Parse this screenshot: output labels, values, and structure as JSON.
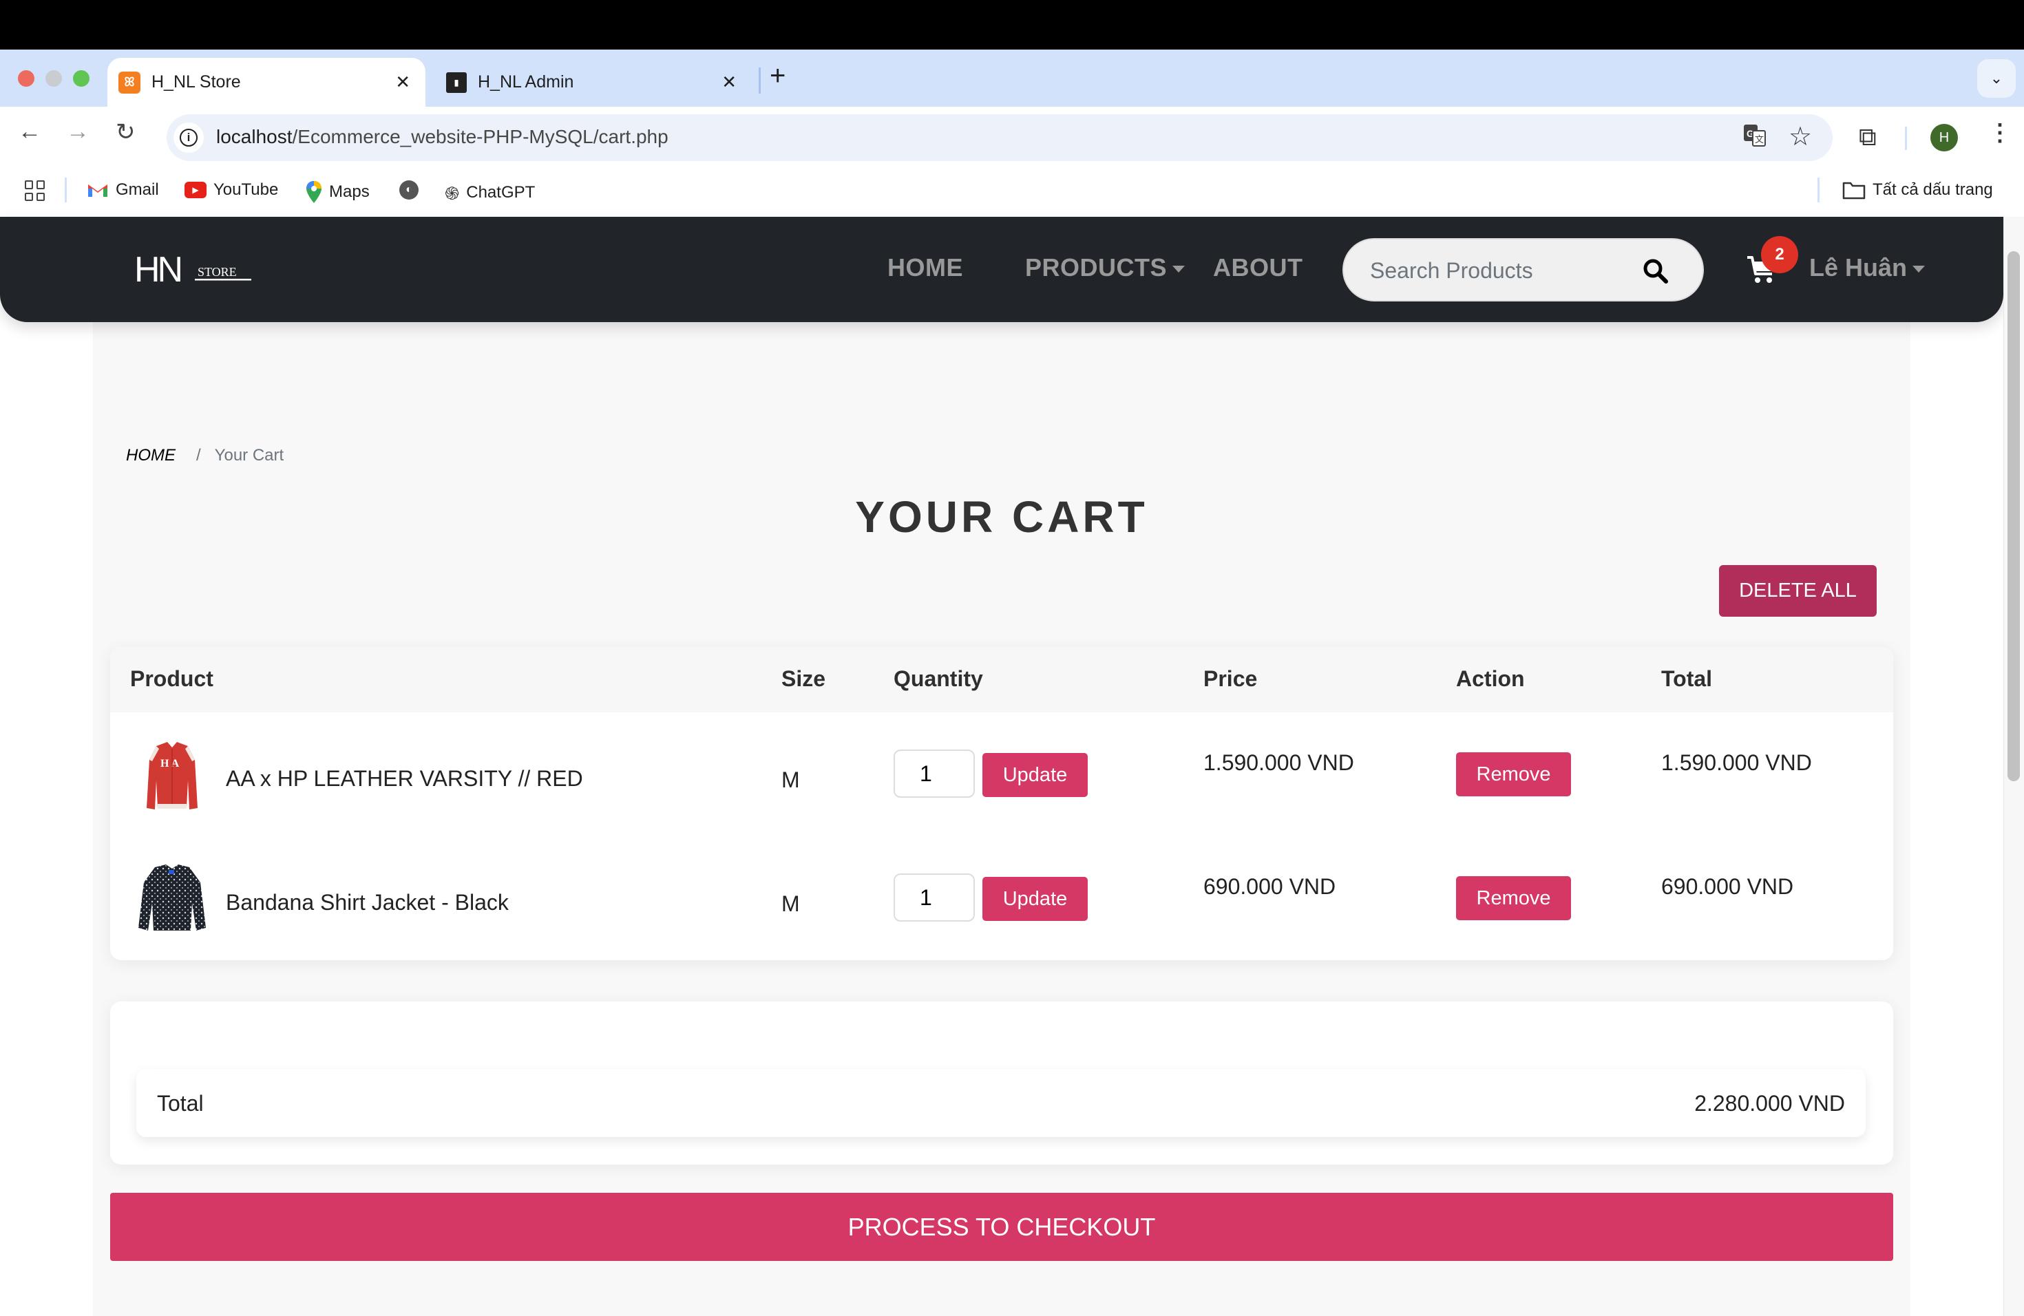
{
  "browser": {
    "tabs": [
      {
        "title": "H_NL Store",
        "active": true,
        "favicon": "xampp-icon"
      },
      {
        "title": "H_NL Admin",
        "active": false,
        "favicon": "admin-icon"
      }
    ],
    "new_tab": "+",
    "url_host": "localhost",
    "url_path": "/Ecommerce_website-PHP-MySQL/cart.php",
    "profile_initial": "H",
    "bookmarks": [
      {
        "label": "Gmail",
        "icon": "gmail-icon"
      },
      {
        "label": "YouTube",
        "icon": "youtube-icon"
      },
      {
        "label": "Maps",
        "icon": "maps-icon"
      },
      {
        "label": "",
        "icon": "globe-icon"
      },
      {
        "label": "ChatGPT",
        "icon": "chatgpt-icon"
      }
    ],
    "all_bookmarks": "Tất cả dấu trang"
  },
  "navbar": {
    "logo_main": "HN",
    "logo_sub": "STORE",
    "links": [
      "HOME",
      "PRODUCTS",
      "ABOUT"
    ],
    "search_placeholder": "Search Products",
    "cart_count": "2",
    "user_name": "Lê Huân"
  },
  "breadcrumb": {
    "home": "HOME",
    "separator": "/",
    "current": "Your Cart"
  },
  "page_title": "YOUR CART",
  "delete_all_label": "DELETE ALL",
  "table": {
    "headers": [
      "Product",
      "Size",
      "Quantity",
      "Price",
      "Action",
      "Total"
    ],
    "rows": [
      {
        "name": "AA x HP LEATHER VARSITY // RED",
        "size": "M",
        "quantity": "1",
        "update_label": "Update",
        "price": "1.590.000 VND",
        "remove_label": "Remove",
        "total": "1.590.000 VND",
        "image": "red-varsity-jacket"
      },
      {
        "name": "Bandana Shirt Jacket - Black",
        "size": "M",
        "quantity": "1",
        "update_label": "Update",
        "price": "690.000 VND",
        "remove_label": "Remove",
        "total": "690.000 VND",
        "image": "black-bandana-jacket"
      }
    ]
  },
  "summary": {
    "label": "Total",
    "value": "2.280.000 VND"
  },
  "checkout_label": "PROCESS TO CHECKOUT",
  "colors": {
    "navbar_bg": "#212529",
    "accent": "#d53864",
    "delete_all": "#b12d5a",
    "badge": "#e03127"
  }
}
